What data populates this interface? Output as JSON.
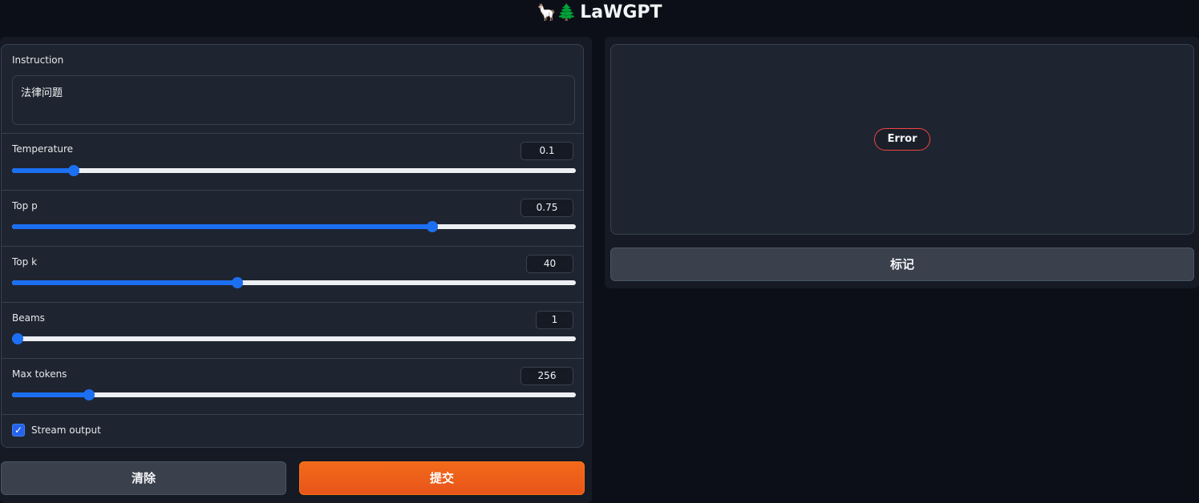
{
  "header": {
    "icons": "🦙🌲",
    "title": "LaWGPT"
  },
  "instruction": {
    "label": "Instruction",
    "value": "法律问题"
  },
  "sliders": [
    {
      "label": "Temperature",
      "value": "0.1",
      "fraction": 0.11
    },
    {
      "label": "Top p",
      "value": "0.75",
      "fraction": 0.745
    },
    {
      "label": "Top k",
      "value": "40",
      "fraction": 0.4
    },
    {
      "label": "Beams",
      "value": "1",
      "fraction": 0.0
    },
    {
      "label": "Max tokens",
      "value": "256",
      "fraction": 0.137
    }
  ],
  "stream": {
    "label": "Stream output",
    "checked": true
  },
  "buttons": {
    "clear": "清除",
    "submit": "提交",
    "flag": "标记"
  },
  "output": {
    "status": "Error"
  },
  "colors": {
    "accent": "#1d6ff2",
    "submit": "#f36a1a",
    "error_border": "#ef4444"
  }
}
